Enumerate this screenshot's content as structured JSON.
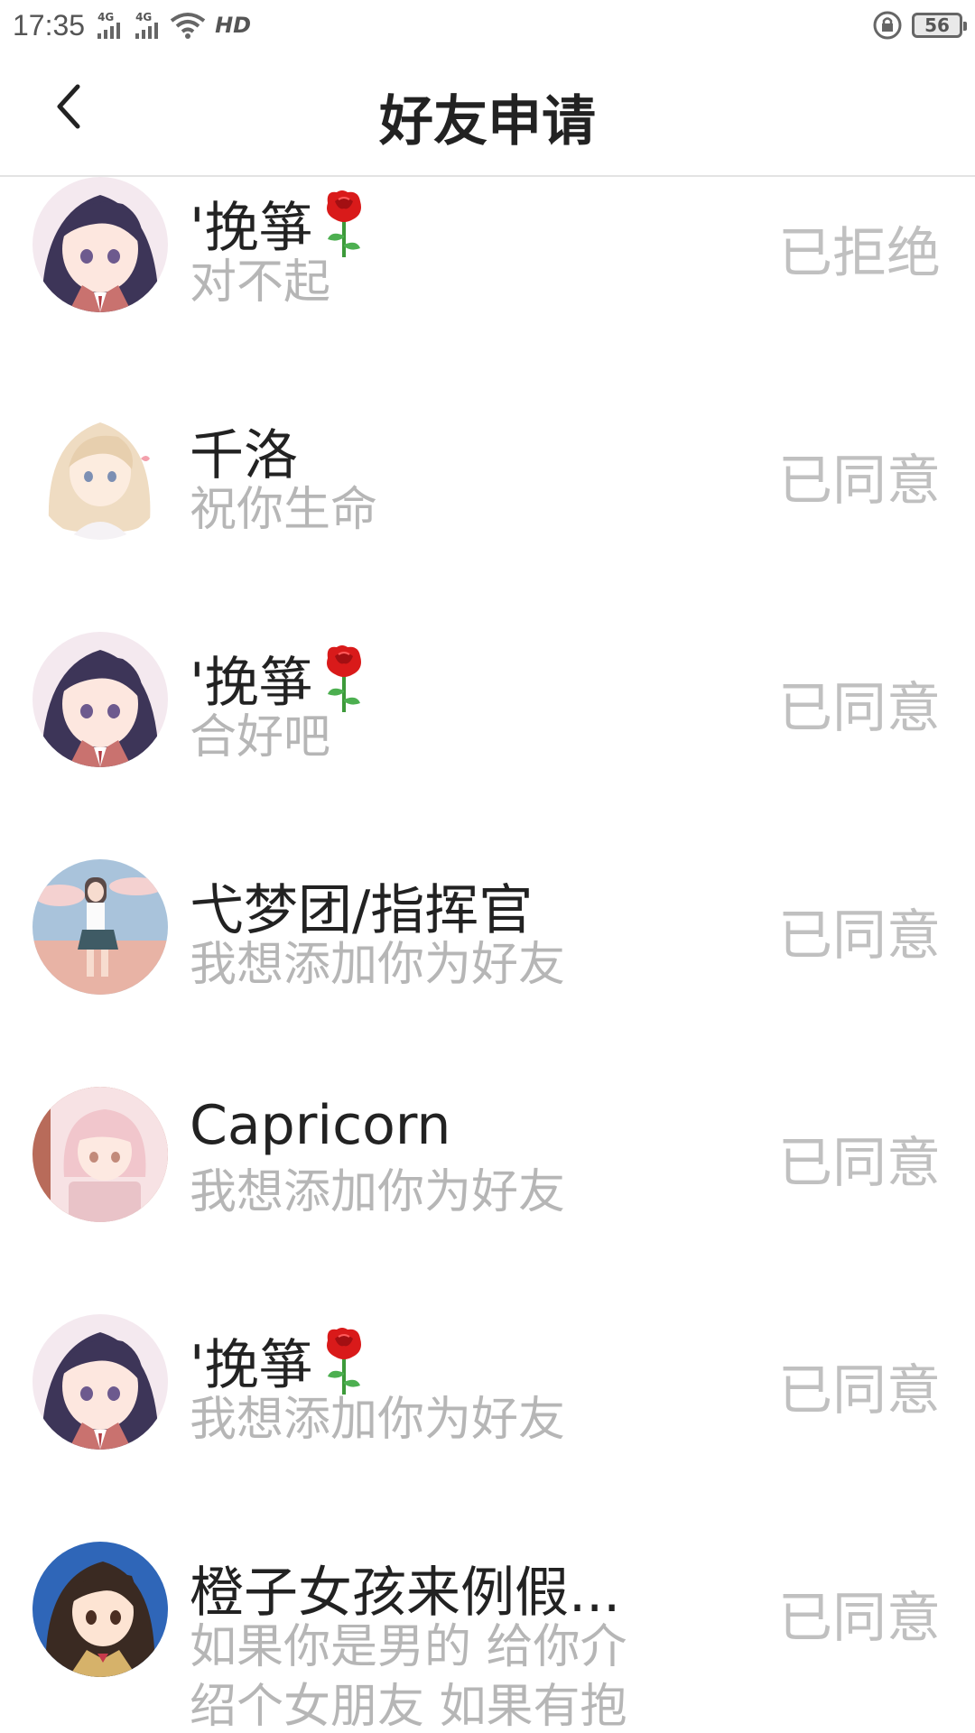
{
  "status_bar": {
    "time": "17:35",
    "signal_1_label": "4G",
    "signal_2_label": "4G",
    "hd_label": "HD",
    "battery": "56"
  },
  "header": {
    "title": "好友申请"
  },
  "requests": [
    {
      "name": "'挽箏",
      "has_rose": true,
      "message": "对不起",
      "status": "已拒绝",
      "avatar": "dark-hair-girl"
    },
    {
      "name": "千洛",
      "has_rose": false,
      "message": "祝你生命",
      "status": "已同意",
      "avatar": "blonde-girl"
    },
    {
      "name": "'挽箏",
      "has_rose": true,
      "message": "合好吧",
      "status": "已同意",
      "avatar": "dark-hair-girl"
    },
    {
      "name": "弋梦团/指挥官",
      "has_rose": false,
      "message": "我想添加你为好友",
      "status": "已同意",
      "avatar": "sky-girl"
    },
    {
      "name": "Capricorn",
      "has_rose": false,
      "message": "我想添加你为好友",
      "status": "已同意",
      "avatar": "pink-hair-girl"
    },
    {
      "name": "'挽箏",
      "has_rose": true,
      "message": "我想添加你为好友",
      "status": "已同意",
      "avatar": "dark-hair-girl"
    },
    {
      "name": "橙子女孩来例假...",
      "has_rose": false,
      "message": "如果你是男的 给你介",
      "message_line2": "绍个女朋友 如果有抱",
      "status": "已同意",
      "avatar": "blue-anime-girl"
    }
  ],
  "colors": {
    "status_text": "#c0c0c0",
    "message_text": "#b6b6b6",
    "name_text": "#222222",
    "rose": "#d91a1a"
  }
}
